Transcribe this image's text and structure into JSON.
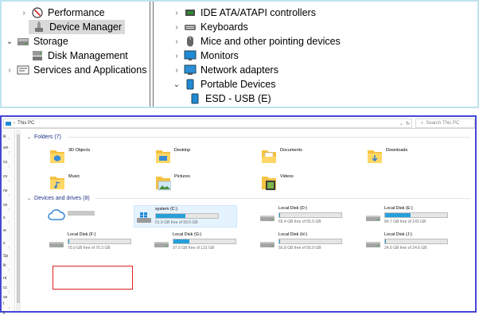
{
  "computer_management": {
    "left_tree": [
      {
        "label": "Performance",
        "expanded": false,
        "icon": "performance-icon"
      },
      {
        "label": "Device Manager",
        "expanded": false,
        "selected": true,
        "icon": "device-manager-icon"
      },
      {
        "label": "Storage",
        "expanded": true,
        "icon": "storage-icon"
      },
      {
        "label": "Disk Management",
        "icon": "disk-management-icon"
      },
      {
        "label": "Services and Applications",
        "expanded": false,
        "icon": "services-icon"
      }
    ],
    "device_tree": [
      {
        "label": "IDE ATA/ATAPI controllers",
        "icon": "ide-controller-icon"
      },
      {
        "label": "Keyboards",
        "icon": "keyboard-icon"
      },
      {
        "label": "Mice and other pointing devices",
        "icon": "mouse-icon"
      },
      {
        "label": "Monitors",
        "icon": "monitor-icon"
      },
      {
        "label": "Network adapters",
        "icon": "network-adapter-icon"
      },
      {
        "label": "Portable Devices",
        "expanded": true,
        "icon": "portable-device-icon"
      },
      {
        "label": "ESD - USB (E)",
        "icon": "portable-device-icon"
      }
    ]
  },
  "explorer": {
    "address": {
      "location": "This PC"
    },
    "search": {
      "placeholder": "Search This PC"
    },
    "sidebar_labels": [
      "ik",
      "wn",
      "cu",
      "co",
      "ne",
      "ov",
      "s",
      "w",
      "s",
      "Sp",
      "ik",
      "nt",
      "cc",
      "ve",
      "t",
      "k"
    ],
    "folders_header": "Folders (7)",
    "folders": [
      {
        "name": "3D Objects",
        "icon": "3d-objects-folder-icon"
      },
      {
        "name": "Desktop",
        "icon": "desktop-folder-icon"
      },
      {
        "name": "Documents",
        "icon": "documents-folder-icon"
      },
      {
        "name": "Downloads",
        "icon": "downloads-folder-icon"
      },
      {
        "name": "Music",
        "icon": "music-folder-icon"
      },
      {
        "name": "Pictures",
        "icon": "pictures-folder-icon"
      },
      {
        "name": "Videos",
        "icon": "videos-folder-icon"
      }
    ],
    "devices_header": "Devices and drives (8)",
    "cloud_item": {
      "name": "",
      "icon": "cloud-icon"
    },
    "drives": [
      {
        "name": "system (C:)",
        "free": "51.9 GB free of 99.5 GB",
        "used_fraction": 0.48,
        "selected": true,
        "icon": "windows-drive-icon"
      },
      {
        "name": "Local Disk (D:)",
        "free": "65.4 GB free of 65.5 GB",
        "used_fraction": 0.01,
        "icon": "hard-drive-icon"
      },
      {
        "name": "Local Disk (E:)",
        "free": "84.7 GB free of 143 GB",
        "used_fraction": 0.41,
        "icon": "hard-drive-icon"
      },
      {
        "name": "Local Disk (F:)",
        "free": "70.0 GB free of 70.3 GB",
        "used_fraction": 0.01,
        "icon": "hard-drive-icon"
      },
      {
        "name": "Local Disk (G:)",
        "free": "97.0 GB free of 131 GB",
        "used_fraction": 0.26,
        "icon": "hard-drive-icon"
      },
      {
        "name": "Local Disk (H:)",
        "free": "56.8 GB free of 56.9 GB",
        "used_fraction": 0.01,
        "icon": "hard-drive-icon"
      },
      {
        "name": "Local Disk (J:)",
        "free": "24.5 GB free of 24.6 GB",
        "used_fraction": 0.01,
        "icon": "hard-drive-icon"
      }
    ]
  },
  "colors": {
    "accent": "#26a0da",
    "highlight_border": "#e02020",
    "panel_border": "#4646d6",
    "top_border": "#bfe3ef"
  }
}
